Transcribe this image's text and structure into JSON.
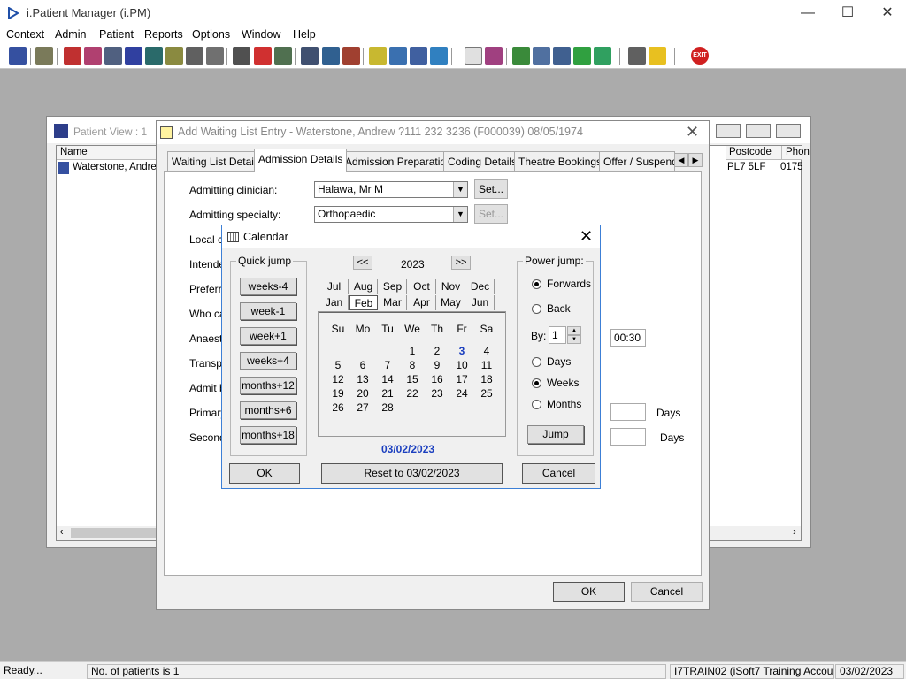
{
  "app": {
    "title": "i.Patient Manager (i.PM)"
  },
  "window_controls": {
    "minimize": "—",
    "maximize": "☐",
    "close": "✕"
  },
  "menu": [
    "Context",
    "Admin",
    "Patient",
    "Reports",
    "Options",
    "Window",
    "Help"
  ],
  "toolbar": {
    "exit_label": "EXIT"
  },
  "patient_view": {
    "title": "Patient View : 1",
    "columns": {
      "name": "Name",
      "postcode": "Postcode",
      "phone": "Phon"
    },
    "row": {
      "name": "Waterstone, Andrew",
      "postcode": "PL7 5LF",
      "phone": "0175"
    }
  },
  "waiting_list_dialog": {
    "title": "Add Waiting List Entry - Waterstone, Andrew ?111 232 3236 (F000039) 08/05/1974",
    "tabs": [
      "Waiting List Details",
      "Admission Details",
      "Admission Preparation",
      "Coding Details",
      "Theatre Bookings",
      "Offer / Suspend"
    ],
    "active_tab": "Admission Details",
    "fields": {
      "admitting_clinician": {
        "label": "Admitting clinician:",
        "value": "Halawa, Mr M",
        "set": "Set..."
      },
      "admitting_specialty": {
        "label": "Admitting specialty:",
        "value": "Orthopaedic",
        "set": "Set..."
      },
      "local_label": "Local ca",
      "intended_label": "Intende",
      "preferred_label": "Preferre",
      "who_label": "Who ca",
      "anaesth_label": "Anaesth",
      "anaesth_time": "00:30",
      "transport_label": "Transpo",
      "admit_by_label": "Admit by",
      "primary_label": "Primary",
      "primary_days": "Days",
      "second_label": "Second",
      "second_days": "Days"
    },
    "ok": "OK",
    "cancel": "Cancel"
  },
  "calendar": {
    "title": "Calendar",
    "quick_jump": {
      "label": "Quick jump",
      "buttons": [
        "weeks-4",
        "week-1",
        "week+1",
        "weeks+4",
        "months+12",
        "months+6",
        "months+18"
      ]
    },
    "year": "2023",
    "prev": "<<",
    "next": ">>",
    "months_row1": [
      "Jul",
      "Aug",
      "Sep",
      "Oct",
      "Nov",
      "Dec"
    ],
    "months_row2": [
      "Jan",
      "Feb",
      "Mar",
      "Apr",
      "May",
      "Jun"
    ],
    "selected_month": "Feb",
    "weekdays": [
      "Su",
      "Mo",
      "Tu",
      "We",
      "Th",
      "Fr",
      "Sa"
    ],
    "first_weekday_index": 3,
    "days_in_month": 28,
    "selected_day": 3,
    "selected_date": "03/02/2023",
    "power_jump": {
      "label": "Power jump:",
      "forwards": "Forwards",
      "back": "Back",
      "direction": "Forwards",
      "by_label": "By:",
      "by_value": "1",
      "units": [
        "Days",
        "Weeks",
        "Months"
      ],
      "unit": "Weeks",
      "jump": "Jump"
    },
    "ok": "OK",
    "reset": "Reset to 03/02/2023",
    "cancel": "Cancel"
  },
  "statusbar": {
    "ready": "Ready...",
    "patients": "No. of patients is 1",
    "account": "I7TRAIN02 (iSoft7 Training Account)",
    "date": "03/02/2023"
  }
}
